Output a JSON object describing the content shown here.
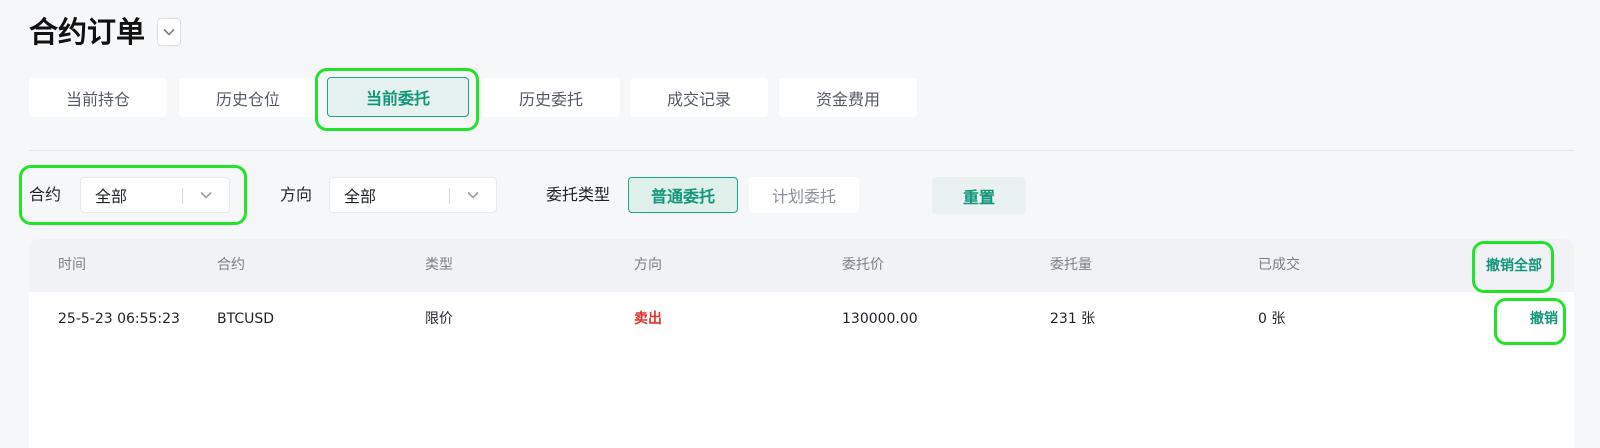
{
  "page": {
    "title": "合约订单"
  },
  "tabs": [
    {
      "label": "当前持仓"
    },
    {
      "label": "历史仓位"
    },
    {
      "label": "当前委托"
    },
    {
      "label": "历史委托"
    },
    {
      "label": "成交记录"
    },
    {
      "label": "资金费用"
    }
  ],
  "filters": {
    "contract_label": "合约",
    "contract_value": "全部",
    "direction_label": "方向",
    "direction_value": "全部",
    "order_type_label": "委托类型",
    "order_type_options": [
      "普通委托",
      "计划委托"
    ],
    "reset_label": "重置"
  },
  "table": {
    "columns": [
      "时间",
      "合约",
      "类型",
      "方向",
      "委托价",
      "委托量",
      "已成交"
    ],
    "cancel_all_label": "撤销全部",
    "rows": [
      {
        "time": "25-5-23 06:55:23",
        "contract": "BTCUSD",
        "type": "限价",
        "direction": "卖出",
        "price": "130000.00",
        "quantity": "231 张",
        "filled": "0 张",
        "action": "撤销"
      }
    ]
  },
  "colors": {
    "accent": "#14967b",
    "sell": "#e0342f",
    "highlight": "#22e22a"
  },
  "icons": {
    "title_dropdown": "chevron-down-icon",
    "select_dropdown": "chevron-down-icon"
  }
}
